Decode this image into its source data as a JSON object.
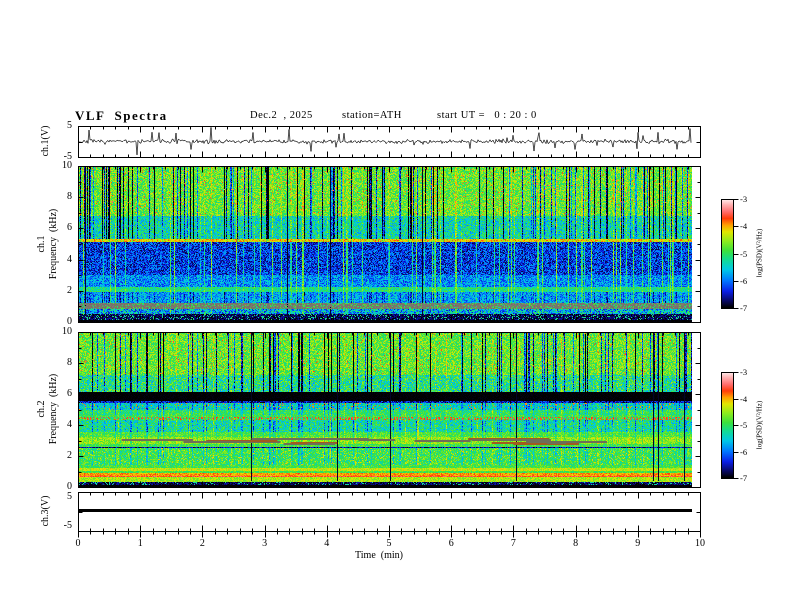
{
  "header": {
    "title": "VLF  Spectra",
    "date": "Dec.2  , 2025",
    "station": "station=ATH",
    "start_ut": "start UT =   0 : 20 : 0"
  },
  "x_axis": {
    "label": "Time  (min)",
    "ticks": [
      0,
      1,
      2,
      3,
      4,
      5,
      6,
      7,
      8,
      9,
      10
    ],
    "minor_step_min": 0.2
  },
  "colors": {
    "background": "#ffffff",
    "frame": "#000000",
    "trace": "#000000"
  },
  "chart_data": [
    {
      "id": "ch1_waveform",
      "type": "line",
      "ylabel": "ch.1(V)",
      "ylim": [
        -5,
        5
      ],
      "y_ticks": [
        "5",
        "-5"
      ],
      "xlim": [
        0,
        10
      ],
      "description": "noisy ~0 V broadband signal with impulsive spikes up to about ±4.5 V",
      "noise_amplitude_V": 0.8,
      "spike_amplitude_V": 4.5,
      "spike_probability": 0.05,
      "seed": 7
    },
    {
      "id": "ch1_spectrogram",
      "type": "heatmap",
      "ylabel_line1": "ch.1",
      "ylabel_line2": "Frequency  (kHz)",
      "ylim": [
        0,
        10
      ],
      "freq_ticks": [
        "10",
        "8",
        "6",
        "4",
        "2",
        "0"
      ],
      "xlim": [
        0,
        10
      ],
      "colorbar": {
        "label": "log(PSD)(V²/Hz)",
        "ticks": [
          "-3",
          "-4",
          "-5",
          "-6",
          "-7"
        ],
        "range": [
          -7,
          -3
        ]
      },
      "seed": 42,
      "vdark_p": 0.2,
      "vlight_p": 0.12,
      "vblack_p": 0.008,
      "bands": [
        {
          "f": [
            6.8,
            10.01
          ],
          "base": -4.75,
          "noise": 0.5,
          "vd": 1.2,
          "vb": 0.3,
          "specks": {
            "p": 0.025,
            "level": -3.6
          }
        },
        {
          "f": [
            5.3,
            6.8
          ],
          "base": -5.35,
          "noise": 0.6,
          "vd": 0.8,
          "vb": 0.5
        },
        {
          "f": [
            5.1,
            5.3
          ],
          "base": -4.15,
          "noise": 0.45,
          "vd": 0.2,
          "vb": 0
        },
        {
          "f": [
            3.0,
            5.1
          ],
          "base": -6.3,
          "noise": 0.55,
          "vd": 0,
          "vb": 1.1
        },
        {
          "f": [
            2.25,
            3.0
          ],
          "base": -5.9,
          "noise": 0.5,
          "vd": 0,
          "vb": 0.8
        },
        {
          "f": [
            1.95,
            2.25
          ],
          "base": -5.15,
          "noise": 0.4,
          "vd": 0,
          "vb": 0.4
        },
        {
          "f": [
            1.2,
            1.95
          ],
          "base": -5.8,
          "noise": 0.5,
          "vd": 0.3,
          "vb": 0.6
        },
        {
          "f": [
            0.85,
            1.2
          ],
          "gray": [
            122,
            118,
            108
          ],
          "speckle_p": 0.22
        },
        {
          "f": [
            0.5,
            0.85
          ],
          "base": -5.7,
          "noise": 0.8,
          "vd": 0,
          "vb": 0.3
        },
        {
          "f": [
            0.12,
            0.5
          ],
          "base": -6.8,
          "noise": 0.25,
          "vd": 0,
          "vb": 0,
          "specks": {
            "p": 0.14,
            "level": -5.2
          }
        },
        {
          "f": [
            0,
            0.12
          ],
          "base": -7,
          "noise": 0.05,
          "vd": 0,
          "vb": 0
        }
      ]
    },
    {
      "id": "ch2_spectrogram",
      "type": "heatmap",
      "ylabel_line1": "ch.2",
      "ylabel_line2": "Frequency  (kHz)",
      "ylim": [
        0,
        10
      ],
      "freq_ticks": [
        "10",
        "8",
        "6",
        "4",
        "2",
        "0"
      ],
      "xlim": [
        0,
        10
      ],
      "colorbar": {
        "label": "log(PSD)(V²/Hz)",
        "ticks": [
          "-3",
          "-4",
          "-5",
          "-6",
          "-7"
        ],
        "range": [
          -7,
          -3
        ]
      },
      "seed": 1337,
      "vdark_p": 0.15,
      "vlight_p": 0.05,
      "vblack_p": 0.014,
      "dashes": {
        "count": 18,
        "f": [
          2.82,
          3.2
        ],
        "len": [
          25,
          85
        ],
        "colors": [
          "#6e6e58",
          "#6e6e58",
          "#6e6e58",
          "#a05a20"
        ]
      },
      "bands": [
        {
          "f": [
            7.2,
            10.01
          ],
          "base": -4.75,
          "noise": 0.5,
          "vd": 1.3,
          "vb": 0.3,
          "specks": {
            "p": 0.02,
            "level": -3.7
          }
        },
        {
          "f": [
            6.1,
            7.2
          ],
          "base": -5.15,
          "noise": 0.7,
          "vd": 1.0,
          "vb": 0.3
        },
        {
          "f": [
            5.42,
            5.58
          ],
          "base": -6.5,
          "noise": 0.5,
          "vd": 0,
          "vb": 0
        },
        {
          "f": [
            4.95,
            5.42
          ],
          "base": -5.45,
          "noise": 0.5,
          "vd": 0.4,
          "vb": 0.3,
          "dots": {
            "p": 0.1,
            "level": -3.9
          }
        },
        {
          "f": [
            4.62,
            4.95
          ],
          "base": -5.0,
          "noise": 0.4,
          "vd": 0.3,
          "vb": 0.3
        },
        {
          "f": [
            4.5,
            4.62
          ],
          "base": -4.9,
          "noise": 0.35,
          "vd": 0.2,
          "vb": 0.2
        },
        {
          "f": [
            4.32,
            4.5
          ],
          "base": -5.0,
          "noise": 0.4,
          "vd": 0,
          "vb": 0,
          "dots": {
            "p": 0.5,
            "level": -3.65
          }
        },
        {
          "f": [
            3.55,
            4.32
          ],
          "base": -5.25,
          "noise": 0.55,
          "vd": 0.4,
          "vb": 0.4
        },
        {
          "f": [
            3.25,
            3.55
          ],
          "base": -4.85,
          "noise": 0.35,
          "vd": 0.2,
          "vb": 0.2
        },
        {
          "f": [
            2.78,
            3.25
          ],
          "base": -4.55,
          "noise": 0.35,
          "vd": 0.2,
          "vb": 0.2
        },
        {
          "f": [
            2.58,
            2.78
          ],
          "base": -4.9,
          "noise": 0.35,
          "vd": 0,
          "vb": 0
        },
        {
          "f": [
            2.5,
            2.58
          ],
          "base": -6.6,
          "noise": 0.4,
          "vd": 0,
          "vb": 0
        },
        {
          "f": [
            1.45,
            2.5
          ],
          "base": -4.95,
          "noise": 0.45,
          "vd": 0.3,
          "vb": 0.3,
          "specks": {
            "p": 0.05,
            "level": -4.2
          }
        },
        {
          "f": [
            1.2,
            1.45
          ],
          "base": -4.9,
          "noise": 0.35,
          "vd": 0,
          "vb": 0
        },
        {
          "f": [
            1.02,
            1.2
          ],
          "base": -4.35,
          "noise": 0.3,
          "vd": 0,
          "vb": 0
        },
        {
          "f": [
            0.9,
            1.02
          ],
          "base": -4.9,
          "noise": 0.3,
          "vd": 0,
          "vb": 0
        },
        {
          "f": [
            0.72,
            0.9
          ],
          "base": -3.95,
          "noise": 0.25,
          "vd": 0,
          "vb": 0
        },
        {
          "f": [
            0.62,
            0.72
          ],
          "base": -3.6,
          "noise": 0.2,
          "vd": 0,
          "vb": 0
        },
        {
          "f": [
            0.35,
            0.62
          ],
          "base": -4.45,
          "noise": 0.3,
          "vd": 0,
          "vb": 0
        },
        {
          "f": [
            0.1,
            0.35
          ],
          "base": -6.8,
          "noise": 0.25,
          "vd": 0,
          "vb": 0,
          "specks": {
            "p": 0.15,
            "level": -5.3
          }
        },
        {
          "f": [
            0,
            0.1
          ],
          "base": -7,
          "noise": 0.05,
          "vd": 0,
          "vb": 0
        }
      ]
    },
    {
      "id": "ch3_waveform",
      "type": "line",
      "ylabel": "ch.3(V)",
      "ylim": [
        -5,
        5
      ],
      "y_ticks": [
        "5",
        "-5"
      ],
      "xlim": [
        0,
        10
      ],
      "value_V": 0.3,
      "description": "constant flat line near 0 V (thick black)"
    }
  ],
  "colormap_stops": [
    [
      -7,
      0,
      0,
      0
    ],
    [
      -6.75,
      8,
      8,
      100
    ],
    [
      -6.4,
      10,
      30,
      230
    ],
    [
      -6.0,
      0,
      120,
      255
    ],
    [
      -5.6,
      0,
      200,
      230
    ],
    [
      -5.2,
      20,
      220,
      140
    ],
    [
      -4.9,
      60,
      225,
      60
    ],
    [
      -4.55,
      140,
      235,
      30
    ],
    [
      -4.2,
      225,
      230,
      0
    ],
    [
      -3.95,
      255,
      160,
      0
    ],
    [
      -3.7,
      255,
      60,
      10
    ],
    [
      -3.45,
      255,
      110,
      110
    ],
    [
      -3.2,
      255,
      175,
      175
    ],
    [
      -3.0,
      255,
      235,
      235
    ]
  ]
}
